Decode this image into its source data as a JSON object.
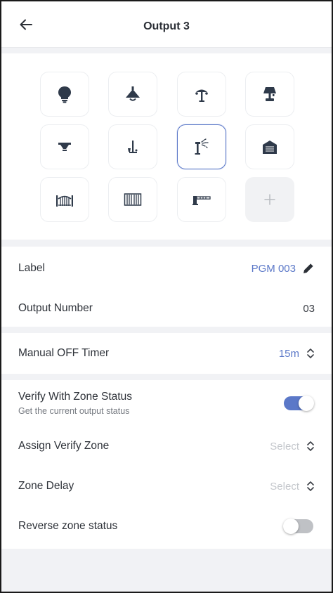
{
  "header": {
    "title": "Output 3",
    "back_icon": "arrow-left-icon"
  },
  "icon_grid": {
    "tiles": [
      {
        "icon": "bulb-icon",
        "selected": false
      },
      {
        "icon": "pendant-lamp-icon",
        "selected": false
      },
      {
        "icon": "garden-lamp-icon",
        "selected": false
      },
      {
        "icon": "table-lamp-icon",
        "selected": false
      },
      {
        "icon": "ceiling-light-icon",
        "selected": false
      },
      {
        "icon": "floor-lamp-icon",
        "selected": false
      },
      {
        "icon": "sprinkler-icon",
        "selected": true
      },
      {
        "icon": "garage-door-icon",
        "selected": false
      },
      {
        "icon": "gate-icon",
        "selected": false
      },
      {
        "icon": "shutter-icon",
        "selected": false
      },
      {
        "icon": "barrier-icon",
        "selected": false
      },
      {
        "icon": "add-icon",
        "selected": false,
        "label": "+"
      }
    ]
  },
  "label_row": {
    "label": "Label",
    "value": "PGM 003"
  },
  "output_number_row": {
    "label": "Output Number",
    "value": "03"
  },
  "timer_row": {
    "label": "Manual OFF Timer",
    "value": "15m"
  },
  "verify_row": {
    "label": "Verify With Zone Status",
    "sublabel": "Get the current output status",
    "enabled": true
  },
  "assign_zone_row": {
    "label": "Assign Verify Zone",
    "value": "Select"
  },
  "zone_delay_row": {
    "label": "Zone Delay",
    "value": "Select"
  },
  "reverse_row": {
    "label": "Reverse zone status",
    "enabled": false
  },
  "colors": {
    "accent": "#5b78c8",
    "icon_dark": "#2f3a4a",
    "placeholder": "#c4c7cc",
    "background": "#f1f2f5"
  }
}
